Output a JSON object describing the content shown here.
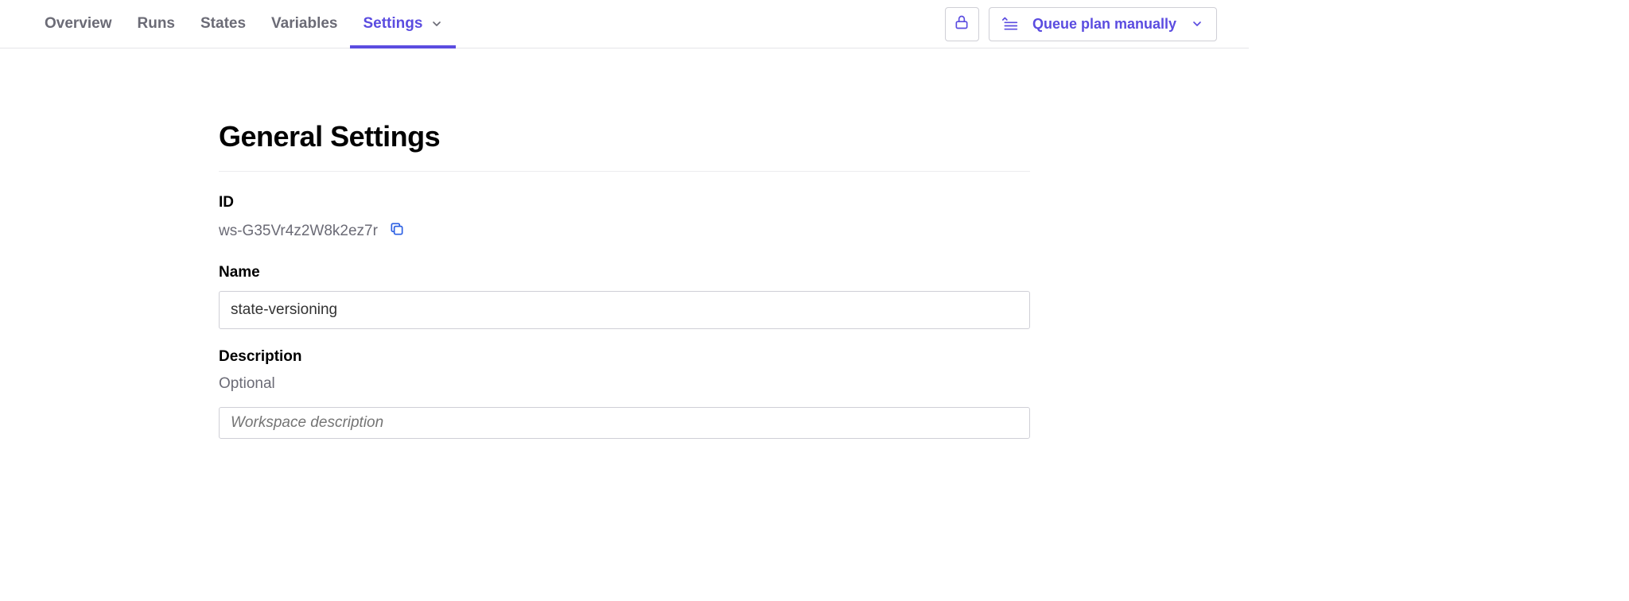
{
  "tabs": {
    "overview": "Overview",
    "runs": "Runs",
    "states": "States",
    "variables": "Variables",
    "settings": "Settings"
  },
  "actions": {
    "queue_label": "Queue plan manually"
  },
  "page": {
    "heading": "General Settings",
    "id_label": "ID",
    "id_value": "ws-G35Vr4z2W8k2ez7r",
    "name_label": "Name",
    "name_value": "state-versioning",
    "description_label": "Description",
    "description_optional": "Optional",
    "description_placeholder": "Workspace description"
  }
}
